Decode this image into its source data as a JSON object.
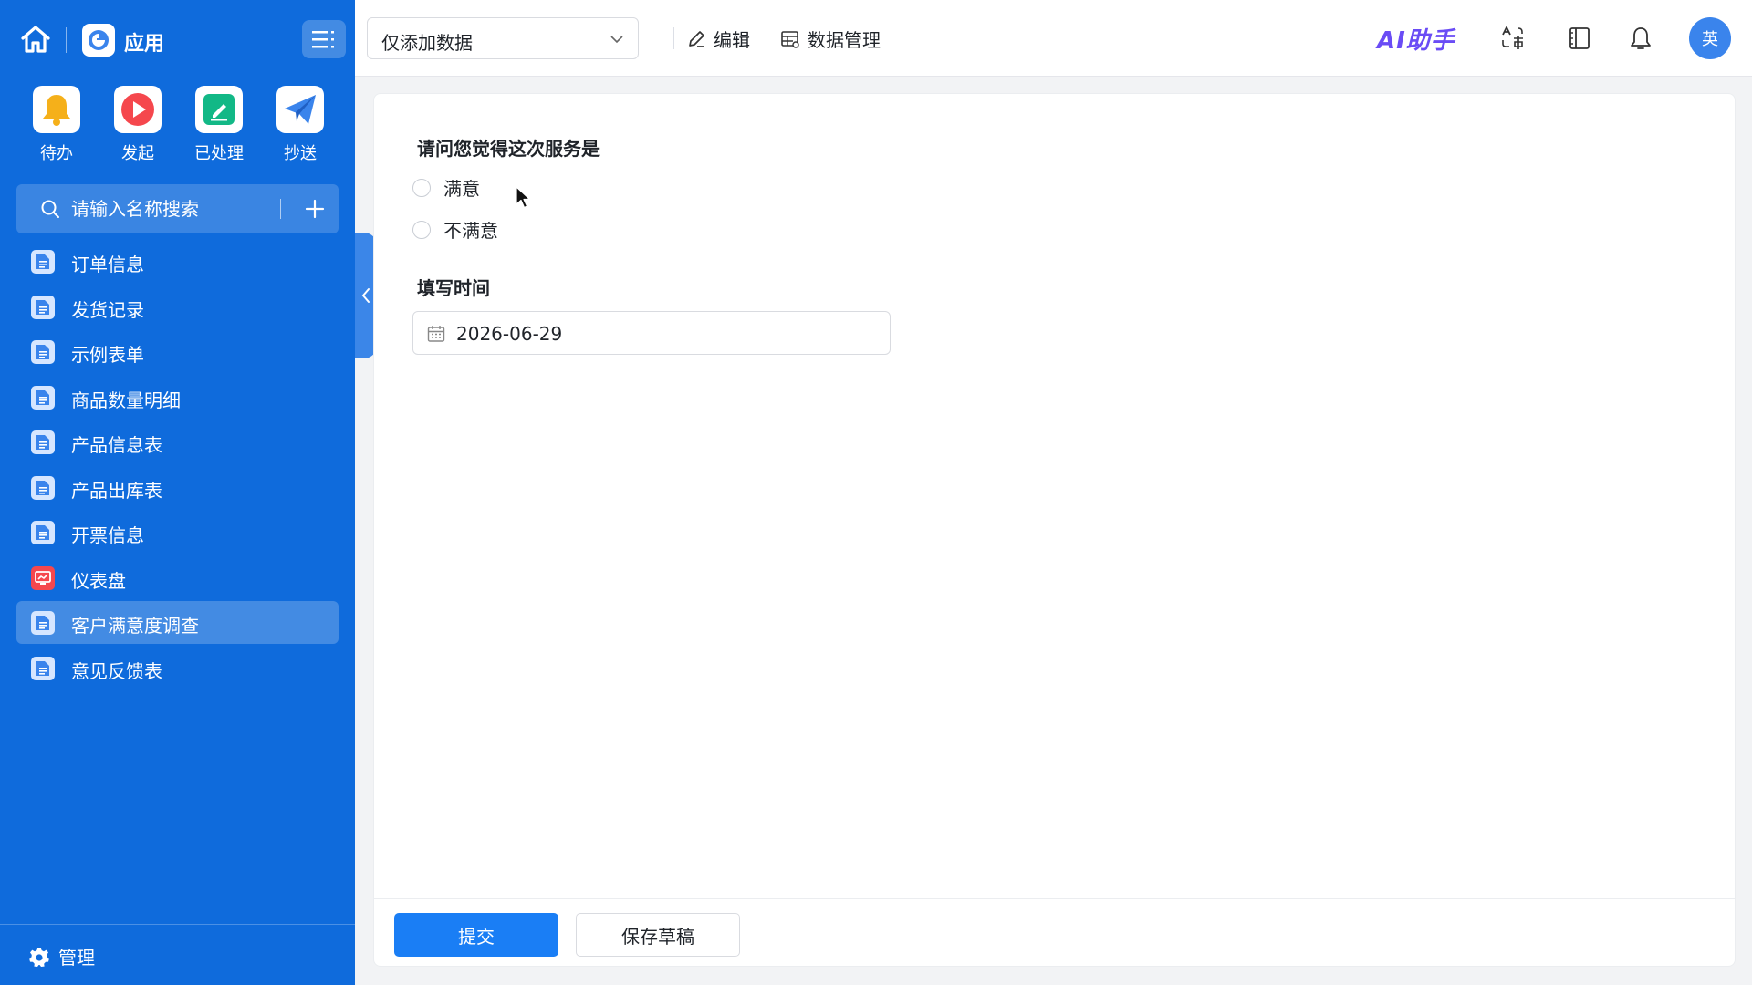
{
  "sidebar": {
    "app_title": "应用",
    "quick_actions": [
      {
        "label": "待办",
        "icon": "bell-icon",
        "color": "#f5b01a"
      },
      {
        "label": "发起",
        "icon": "play-icon",
        "color": "#f5474d"
      },
      {
        "label": "已处理",
        "icon": "check-edit-icon",
        "color": "#12b886"
      },
      {
        "label": "抄送",
        "icon": "paper-plane-icon",
        "color": "#3a84ec"
      }
    ],
    "search": {
      "placeholder": "请输入名称搜索"
    },
    "items": [
      {
        "label": "订单信息",
        "icon": "document-icon"
      },
      {
        "label": "发货记录",
        "icon": "document-icon"
      },
      {
        "label": "示例表单",
        "icon": "document-icon"
      },
      {
        "label": "商品数量明细",
        "icon": "document-icon"
      },
      {
        "label": "产品信息表",
        "icon": "document-icon"
      },
      {
        "label": "产品出库表",
        "icon": "document-icon"
      },
      {
        "label": "开票信息",
        "icon": "document-icon"
      },
      {
        "label": "仪表盘",
        "icon": "dashboard-icon"
      },
      {
        "label": "客户满意度调查",
        "icon": "document-icon",
        "active": true
      },
      {
        "label": "意见反馈表",
        "icon": "document-icon"
      }
    ],
    "footer": {
      "manage_label": "管理"
    }
  },
  "topbar": {
    "view_select": {
      "value": "仅添加数据"
    },
    "edit_label": "编辑",
    "data_manage_label": "数据管理",
    "ai_label": "AI助手",
    "avatar_text": "英"
  },
  "form": {
    "question_label": "请问您觉得这次服务是",
    "options": [
      "满意",
      "不满意"
    ],
    "date_label": "填写时间",
    "date_value": "2026-06-29",
    "submit_label": "提交",
    "draft_label": "保存草稿"
  },
  "colors": {
    "sidebar_bg": "#0f6bdc",
    "primary": "#1a7ef5",
    "ai_accent": "#6a4cf5"
  }
}
